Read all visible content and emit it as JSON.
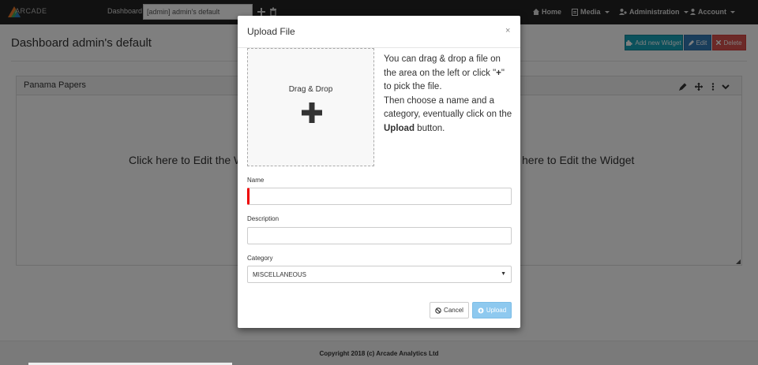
{
  "navbar": {
    "logo_text": "ARCADE",
    "dashboard_label": "Dashboard",
    "dashboard_value": "[admin] admin's default",
    "home": "Home",
    "media": "Media",
    "administration": "Administration",
    "account": "Account"
  },
  "page": {
    "title": "Dashboard admin's default",
    "add_widget": "Add new Widget",
    "edit": "Edit",
    "delete": "Delete"
  },
  "widget": {
    "title": "Panama Papers",
    "body_left": "Click here to Edit the W",
    "body_right": "here to Edit the Widget"
  },
  "footer": {
    "text": "Copyright 2018 (c) Arcade Analytics Ltd"
  },
  "modal": {
    "title": "Upload File",
    "close": "×",
    "dropzone_label": "Drag & Drop",
    "instr_1": "You can drag & drop a file on the area on the left or click \"",
    "instr_plus": "+",
    "instr_2": "\" to pick the file.",
    "instr_3": "Then choose a name and a category, eventually click on the ",
    "instr_upload": "Upload",
    "instr_4": " button.",
    "name_label": "Name",
    "name_value": "",
    "description_label": "Description",
    "description_value": "",
    "category_label": "Category",
    "category_value": "MISCELLANEOUS",
    "cancel": "Cancel",
    "upload": "Upload"
  },
  "colors": {
    "navbar": "#222222",
    "add_widget": "#17a2b8",
    "edit": "#337ab7",
    "delete": "#d9534f",
    "upload_button": "#8ec9ef",
    "focus_indicator": "#ee0000"
  }
}
